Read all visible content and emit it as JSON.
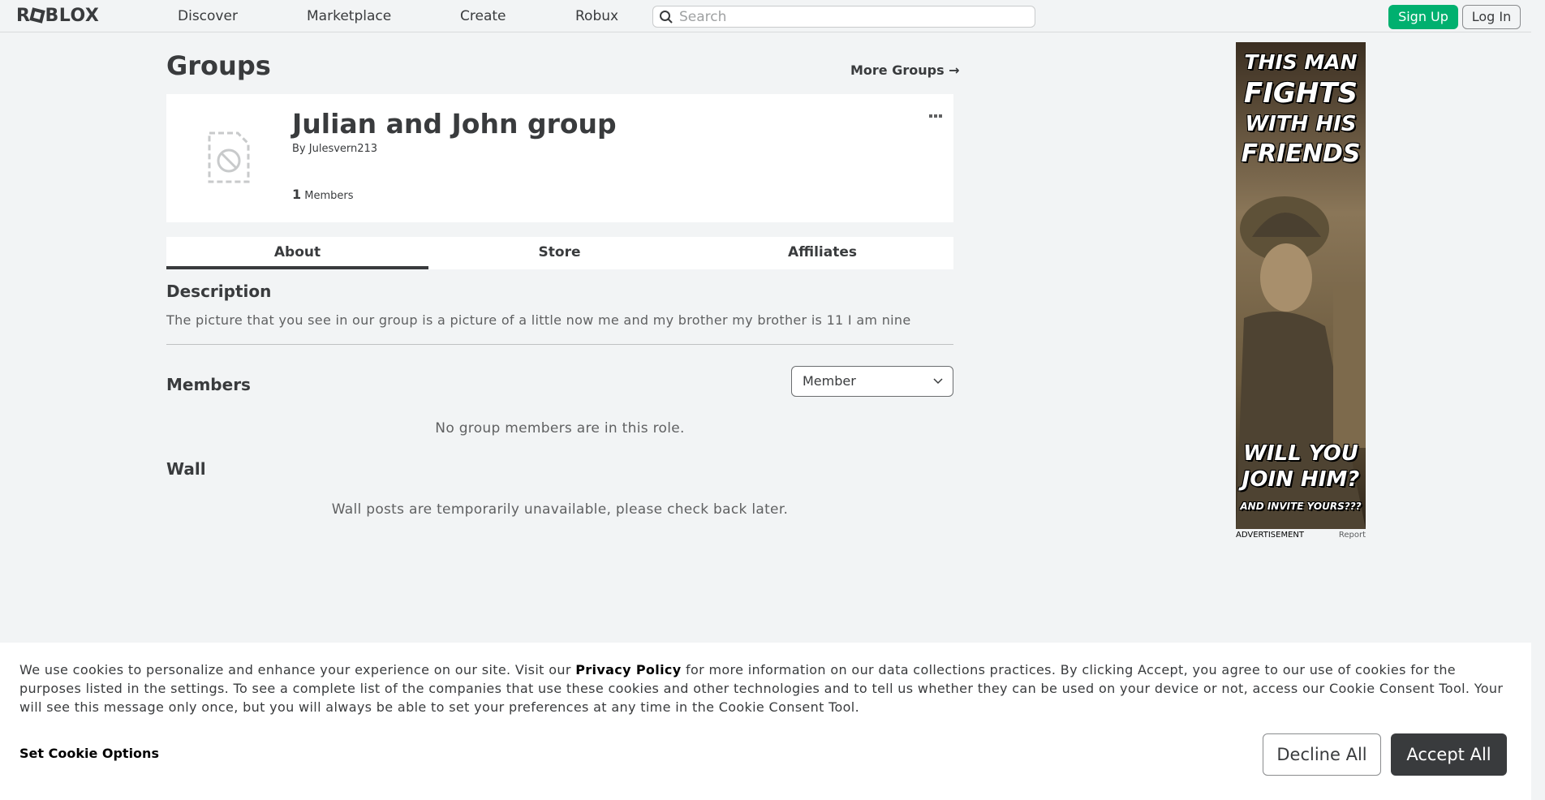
{
  "header": {
    "logo": "ROBLOX",
    "nav": [
      "Discover",
      "Marketplace",
      "Create",
      "Robux"
    ],
    "search_placeholder": "Search",
    "signup_label": "Sign Up",
    "login_label": "Log In"
  },
  "page": {
    "title": "Groups",
    "more_groups": "More Groups →"
  },
  "group": {
    "name": "Julian and John group",
    "by_label": "By",
    "owner": "Julesvern213",
    "member_count": "1",
    "members_label": "Members"
  },
  "tabs": [
    "About",
    "Store",
    "Affiliates"
  ],
  "description": {
    "title": "Description",
    "text": "The picture that you see in our group is a picture of a little now me and my brother my brother is 11 I am nine"
  },
  "members": {
    "title": "Members",
    "role_selected": "Member",
    "empty_message": "No group members are in this role."
  },
  "wall": {
    "title": "Wall",
    "message": "Wall posts are temporarily unavailable, please check back later."
  },
  "ad": {
    "line1": "THIS MAN",
    "line2": "FIGHTS",
    "line3": "WITH HIS",
    "line4": "FRIENDS",
    "line5": "WILL YOU",
    "line6": "JOIN HIM?",
    "line7": "AND INVITE YOURS???",
    "label": "ADVERTISEMENT",
    "report": "Report"
  },
  "cookie": {
    "text_before": "We use cookies to personalize and enhance your experience on our site. Visit our ",
    "privacy_link": "Privacy Policy",
    "text_after": " for more information on our data collections practices. By clicking Accept, you agree to our use of cookies for the purposes listed in the settings. To see a complete list of the companies that use these cookies and other technologies and to tell us whether they can be used on your device or not, access our Cookie Consent Tool. Your will see this message only once, but you will always be able to set your preferences at any time in the Cookie Consent Tool.",
    "options_label": "Set Cookie Options",
    "decline_label": "Decline All",
    "accept_label": "Accept All"
  },
  "colors": {
    "accent_green": "#00b06f",
    "text_dark": "#393b3d",
    "background": "#f2f4f5"
  }
}
